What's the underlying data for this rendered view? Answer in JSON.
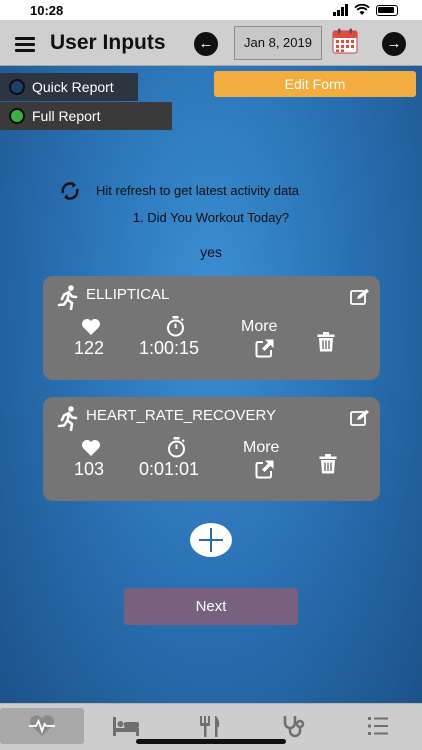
{
  "status_bar": {
    "time": "10:28"
  },
  "nav": {
    "title": "User Inputs",
    "date": "Jan 8, 2019"
  },
  "reports": {
    "quick": "Quick Report",
    "full": "Full Report"
  },
  "edit_form_label": "Edit Form",
  "refresh_text": "Hit refresh to get latest activity data",
  "question": "1. Did You Workout Today?",
  "answer": "yes",
  "activities": [
    {
      "name": "ELLIPTICAL",
      "heart_rate": "122",
      "duration": "1:00:15",
      "more_label": "More"
    },
    {
      "name": "HEART_RATE_RECOVERY",
      "heart_rate": "103",
      "duration": "0:01:01",
      "more_label": "More"
    }
  ],
  "next_label": "Next",
  "tabs": [
    {
      "icon": "heart-rate-icon",
      "active": true
    },
    {
      "icon": "bed-icon",
      "active": false
    },
    {
      "icon": "utensils-icon",
      "active": false
    },
    {
      "icon": "stethoscope-icon",
      "active": false
    },
    {
      "icon": "list-icon",
      "active": false
    }
  ],
  "colors": {
    "accent": "#f3ad3f",
    "next_button": "#77617f",
    "card": "#757575",
    "full_report_dot": "#3cb043"
  }
}
